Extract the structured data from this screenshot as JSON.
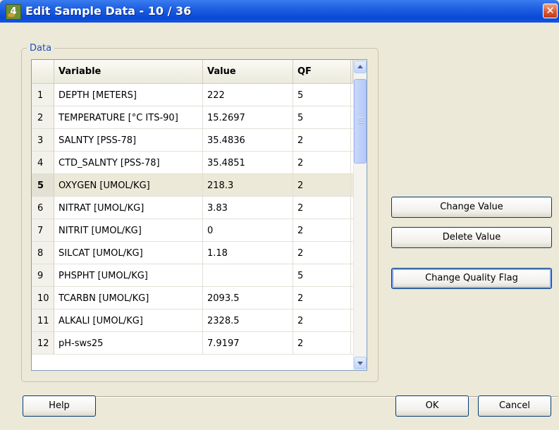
{
  "window": {
    "title": "Edit Sample Data - 10 / 36",
    "close_glyph": "✕",
    "icon_glyph": "4"
  },
  "group": {
    "label": "Data"
  },
  "table": {
    "columns": [
      "Variable",
      "Value",
      "QF"
    ],
    "rows": [
      {
        "num": "1",
        "variable": "DEPTH [METERS]",
        "value": "222",
        "qf": "5"
      },
      {
        "num": "2",
        "variable": "TEMPERATURE [°C ITS-90]",
        "value": "15.2697",
        "qf": "5"
      },
      {
        "num": "3",
        "variable": "SALNTY [PSS-78]",
        "value": "35.4836",
        "qf": "2"
      },
      {
        "num": "4",
        "variable": "CTD_SALNTY [PSS-78]",
        "value": "35.4851",
        "qf": "2"
      },
      {
        "num": "5",
        "variable": "OXYGEN [UMOL/KG]",
        "value": "218.3",
        "qf": "2"
      },
      {
        "num": "6",
        "variable": "NITRAT [UMOL/KG]",
        "value": "3.83",
        "qf": "2"
      },
      {
        "num": "7",
        "variable": "NITRIT [UMOL/KG]",
        "value": "0",
        "qf": "2"
      },
      {
        "num": "8",
        "variable": "SILCAT [UMOL/KG]",
        "value": "1.18",
        "qf": "2"
      },
      {
        "num": "9",
        "variable": "PHSPHT [UMOL/KG]",
        "value": "",
        "qf": "5"
      },
      {
        "num": "10",
        "variable": "TCARBN [UMOL/KG]",
        "value": "2093.5",
        "qf": "2"
      },
      {
        "num": "11",
        "variable": "ALKALI [UMOL/KG]",
        "value": "2328.5",
        "qf": "2"
      },
      {
        "num": "12",
        "variable": "pH-sws25",
        "value": "7.9197",
        "qf": "2"
      }
    ],
    "selected_row": "5"
  },
  "actions": {
    "change_value": "Change Value",
    "delete_value": "Delete Value",
    "change_quality_flag": "Change Quality Flag"
  },
  "footer": {
    "help": "Help",
    "ok": "OK",
    "cancel": "Cancel"
  },
  "colors": {
    "titlebar": "#0a49d6",
    "dialog_bg": "#ece9d8",
    "group_label": "#1f4fbf",
    "close_button": "#d7542f"
  }
}
